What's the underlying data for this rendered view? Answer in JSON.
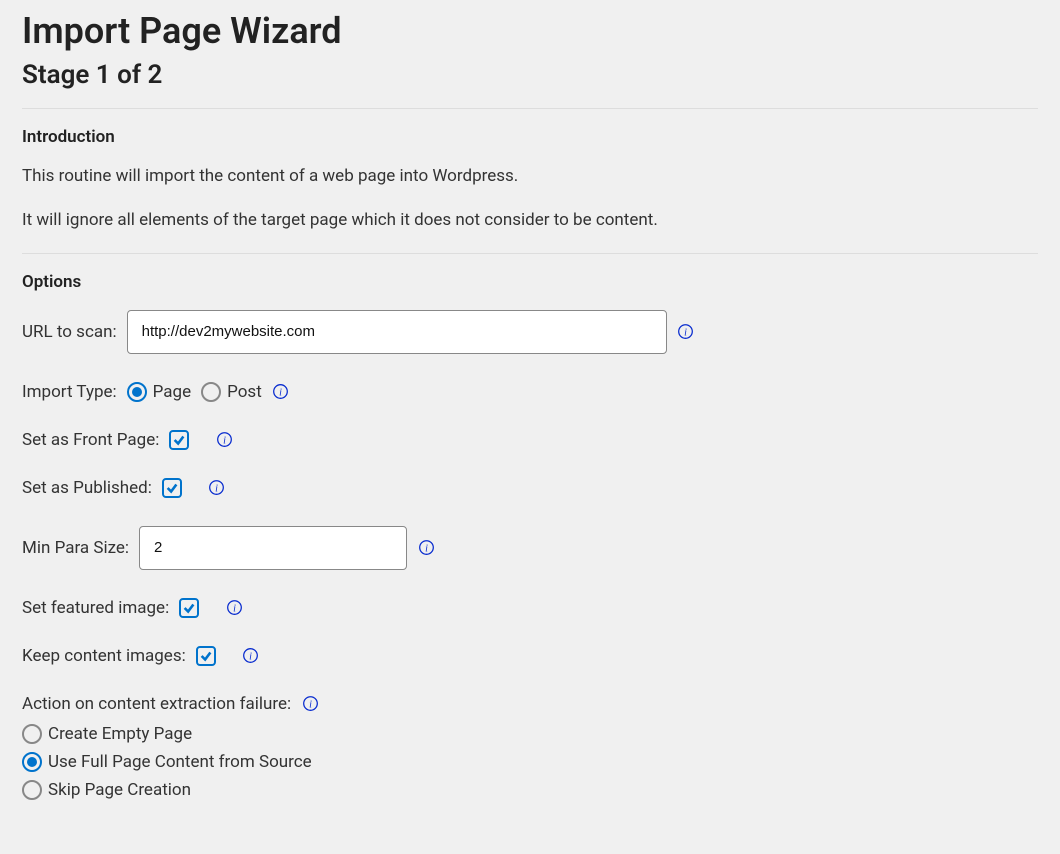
{
  "page_title": "Import Page Wizard",
  "stage_title": "Stage 1 of 2",
  "intro": {
    "heading": "Introduction",
    "line1": "This routine will import the content of a web page into Wordpress.",
    "line2": "It will ignore all elements of the target page which it does not consider to be content."
  },
  "options": {
    "heading": "Options",
    "url": {
      "label": "URL to scan:",
      "value": "http://dev2mywebsite.com"
    },
    "import_type": {
      "label": "Import Type:",
      "page_label": "Page",
      "post_label": "Post",
      "selected": "page"
    },
    "set_front_page": {
      "label": "Set as Front Page:",
      "checked": true
    },
    "set_published": {
      "label": "Set as Published:",
      "checked": true
    },
    "min_para_size": {
      "label": "Min Para Size:",
      "value": "2"
    },
    "set_featured": {
      "label": "Set featured image:",
      "checked": true
    },
    "keep_images": {
      "label": "Keep content images:",
      "checked": true
    },
    "failure_action": {
      "label": "Action on content extraction failure:",
      "options": {
        "empty": "Create Empty Page",
        "full": "Use Full Page Content from Source",
        "skip": "Skip Page Creation"
      },
      "selected": "full"
    }
  }
}
